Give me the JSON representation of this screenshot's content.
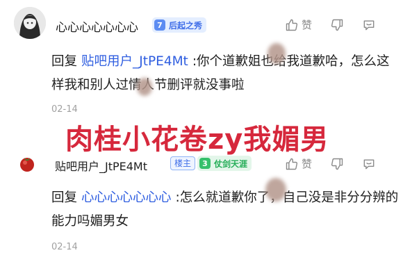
{
  "comments": [
    {
      "username": "心心心心心心心",
      "level_number": "7",
      "level_title": "后起之秀",
      "like_label": "赞",
      "reply_prefix": "回复",
      "mention": "贴吧用户_JtPE4Mt",
      "text": ":你个道歉姐也给我道歉哈，怎么这样我和别人过情人节删评就没事啦",
      "date": "02-14"
    },
    {
      "username": "贴吧用户_JtPE4Mt",
      "owner_badge": "楼主",
      "level_number": "3",
      "level_title": "仗剑天涯",
      "like_label": "赞",
      "reply_prefix": "回复",
      "mention": "心心心心心心心",
      "text": ":怎么就道歉你了，自己没是非分分辨的能力吗媚男女",
      "date": "02-14"
    }
  ],
  "overlay_caption": "肉桂小花卷zy我媚男",
  "colors": {
    "mention": "#2f5ee0",
    "overlay": "#d6283c",
    "level_blue": "#5c8cf2",
    "level_green": "#36c06b"
  },
  "icons": [
    "thumb-up-icon",
    "thumb-down-icon",
    "comment-icon"
  ]
}
